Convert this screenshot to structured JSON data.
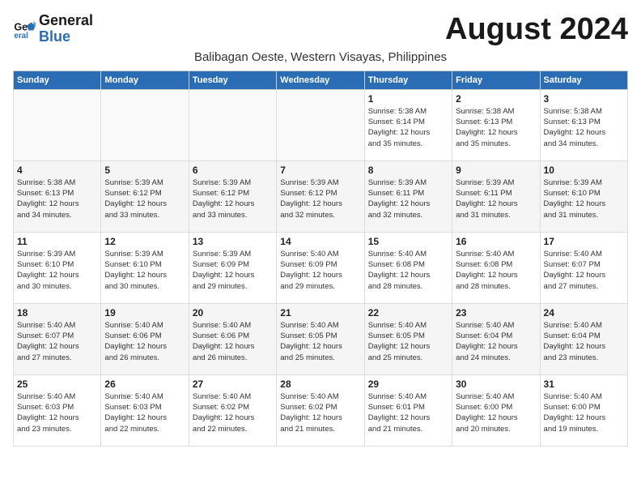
{
  "header": {
    "logo_line1": "General",
    "logo_line2": "Blue",
    "title": "August 2024",
    "subtitle": "Balibagan Oeste, Western Visayas, Philippines"
  },
  "weekdays": [
    "Sunday",
    "Monday",
    "Tuesday",
    "Wednesday",
    "Thursday",
    "Friday",
    "Saturday"
  ],
  "weeks": [
    [
      {
        "day": "",
        "info": ""
      },
      {
        "day": "",
        "info": ""
      },
      {
        "day": "",
        "info": ""
      },
      {
        "day": "",
        "info": ""
      },
      {
        "day": "1",
        "info": "Sunrise: 5:38 AM\nSunset: 6:14 PM\nDaylight: 12 hours\nand 35 minutes."
      },
      {
        "day": "2",
        "info": "Sunrise: 5:38 AM\nSunset: 6:13 PM\nDaylight: 12 hours\nand 35 minutes."
      },
      {
        "day": "3",
        "info": "Sunrise: 5:38 AM\nSunset: 6:13 PM\nDaylight: 12 hours\nand 34 minutes."
      }
    ],
    [
      {
        "day": "4",
        "info": "Sunrise: 5:38 AM\nSunset: 6:13 PM\nDaylight: 12 hours\nand 34 minutes."
      },
      {
        "day": "5",
        "info": "Sunrise: 5:39 AM\nSunset: 6:12 PM\nDaylight: 12 hours\nand 33 minutes."
      },
      {
        "day": "6",
        "info": "Sunrise: 5:39 AM\nSunset: 6:12 PM\nDaylight: 12 hours\nand 33 minutes."
      },
      {
        "day": "7",
        "info": "Sunrise: 5:39 AM\nSunset: 6:12 PM\nDaylight: 12 hours\nand 32 minutes."
      },
      {
        "day": "8",
        "info": "Sunrise: 5:39 AM\nSunset: 6:11 PM\nDaylight: 12 hours\nand 32 minutes."
      },
      {
        "day": "9",
        "info": "Sunrise: 5:39 AM\nSunset: 6:11 PM\nDaylight: 12 hours\nand 31 minutes."
      },
      {
        "day": "10",
        "info": "Sunrise: 5:39 AM\nSunset: 6:10 PM\nDaylight: 12 hours\nand 31 minutes."
      }
    ],
    [
      {
        "day": "11",
        "info": "Sunrise: 5:39 AM\nSunset: 6:10 PM\nDaylight: 12 hours\nand 30 minutes."
      },
      {
        "day": "12",
        "info": "Sunrise: 5:39 AM\nSunset: 6:10 PM\nDaylight: 12 hours\nand 30 minutes."
      },
      {
        "day": "13",
        "info": "Sunrise: 5:39 AM\nSunset: 6:09 PM\nDaylight: 12 hours\nand 29 minutes."
      },
      {
        "day": "14",
        "info": "Sunrise: 5:40 AM\nSunset: 6:09 PM\nDaylight: 12 hours\nand 29 minutes."
      },
      {
        "day": "15",
        "info": "Sunrise: 5:40 AM\nSunset: 6:08 PM\nDaylight: 12 hours\nand 28 minutes."
      },
      {
        "day": "16",
        "info": "Sunrise: 5:40 AM\nSunset: 6:08 PM\nDaylight: 12 hours\nand 28 minutes."
      },
      {
        "day": "17",
        "info": "Sunrise: 5:40 AM\nSunset: 6:07 PM\nDaylight: 12 hours\nand 27 minutes."
      }
    ],
    [
      {
        "day": "18",
        "info": "Sunrise: 5:40 AM\nSunset: 6:07 PM\nDaylight: 12 hours\nand 27 minutes."
      },
      {
        "day": "19",
        "info": "Sunrise: 5:40 AM\nSunset: 6:06 PM\nDaylight: 12 hours\nand 26 minutes."
      },
      {
        "day": "20",
        "info": "Sunrise: 5:40 AM\nSunset: 6:06 PM\nDaylight: 12 hours\nand 26 minutes."
      },
      {
        "day": "21",
        "info": "Sunrise: 5:40 AM\nSunset: 6:05 PM\nDaylight: 12 hours\nand 25 minutes."
      },
      {
        "day": "22",
        "info": "Sunrise: 5:40 AM\nSunset: 6:05 PM\nDaylight: 12 hours\nand 25 minutes."
      },
      {
        "day": "23",
        "info": "Sunrise: 5:40 AM\nSunset: 6:04 PM\nDaylight: 12 hours\nand 24 minutes."
      },
      {
        "day": "24",
        "info": "Sunrise: 5:40 AM\nSunset: 6:04 PM\nDaylight: 12 hours\nand 23 minutes."
      }
    ],
    [
      {
        "day": "25",
        "info": "Sunrise: 5:40 AM\nSunset: 6:03 PM\nDaylight: 12 hours\nand 23 minutes."
      },
      {
        "day": "26",
        "info": "Sunrise: 5:40 AM\nSunset: 6:03 PM\nDaylight: 12 hours\nand 22 minutes."
      },
      {
        "day": "27",
        "info": "Sunrise: 5:40 AM\nSunset: 6:02 PM\nDaylight: 12 hours\nand 22 minutes."
      },
      {
        "day": "28",
        "info": "Sunrise: 5:40 AM\nSunset: 6:02 PM\nDaylight: 12 hours\nand 21 minutes."
      },
      {
        "day": "29",
        "info": "Sunrise: 5:40 AM\nSunset: 6:01 PM\nDaylight: 12 hours\nand 21 minutes."
      },
      {
        "day": "30",
        "info": "Sunrise: 5:40 AM\nSunset: 6:00 PM\nDaylight: 12 hours\nand 20 minutes."
      },
      {
        "day": "31",
        "info": "Sunrise: 5:40 AM\nSunset: 6:00 PM\nDaylight: 12 hours\nand 19 minutes."
      }
    ]
  ]
}
